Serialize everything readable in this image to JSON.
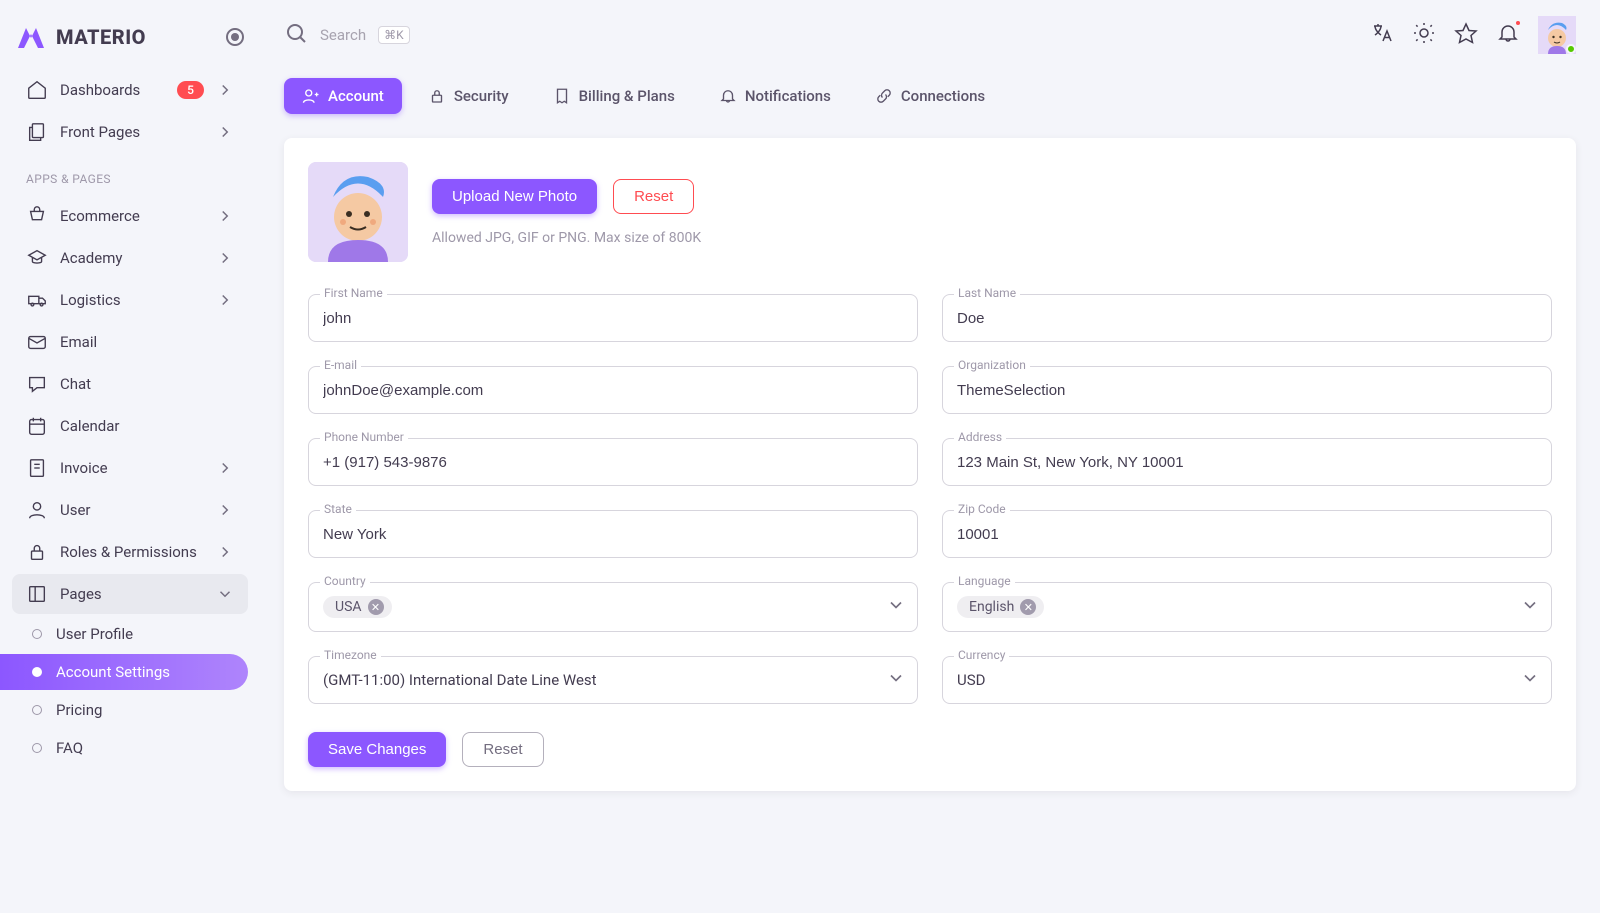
{
  "brand": "MATERIO",
  "search": {
    "placeholder": "Search",
    "shortcut": "⌘K"
  },
  "sidebar": {
    "dashboards": {
      "label": "Dashboards",
      "badge": "5"
    },
    "front_pages": {
      "label": "Front Pages"
    },
    "section_apps": "APPS & PAGES",
    "items": [
      {
        "label": "Ecommerce"
      },
      {
        "label": "Academy"
      },
      {
        "label": "Logistics"
      },
      {
        "label": "Email"
      },
      {
        "label": "Chat"
      },
      {
        "label": "Calendar"
      },
      {
        "label": "Invoice"
      },
      {
        "label": "User"
      },
      {
        "label": "Roles & Permissions"
      },
      {
        "label": "Pages"
      }
    ],
    "sub": [
      {
        "label": "User Profile"
      },
      {
        "label": "Account Settings"
      },
      {
        "label": "Pricing"
      },
      {
        "label": "FAQ"
      }
    ]
  },
  "tabs": [
    {
      "label": "Account"
    },
    {
      "label": "Security"
    },
    {
      "label": "Billing & Plans"
    },
    {
      "label": "Notifications"
    },
    {
      "label": "Connections"
    }
  ],
  "photo": {
    "upload": "Upload New Photo",
    "reset": "Reset",
    "hint": "Allowed JPG, GIF or PNG. Max size of 800K"
  },
  "fields": {
    "first_name": {
      "label": "First Name",
      "value": "john"
    },
    "last_name": {
      "label": "Last Name",
      "value": "Doe"
    },
    "email": {
      "label": "E-mail",
      "value": "johnDoe@example.com"
    },
    "organization": {
      "label": "Organization",
      "value": "ThemeSelection"
    },
    "phone": {
      "label": "Phone Number",
      "value": "+1 (917) 543-9876"
    },
    "address": {
      "label": "Address",
      "value": "123 Main St, New York, NY 10001"
    },
    "state": {
      "label": "State",
      "value": "New York"
    },
    "zip": {
      "label": "Zip Code",
      "value": "10001"
    },
    "country": {
      "label": "Country",
      "chip": "USA"
    },
    "language": {
      "label": "Language",
      "chip": "English"
    },
    "timezone": {
      "label": "Timezone",
      "value": "(GMT-11:00) International Date Line West"
    },
    "currency": {
      "label": "Currency",
      "value": "USD"
    }
  },
  "actions": {
    "save": "Save Changes",
    "reset": "Reset"
  }
}
